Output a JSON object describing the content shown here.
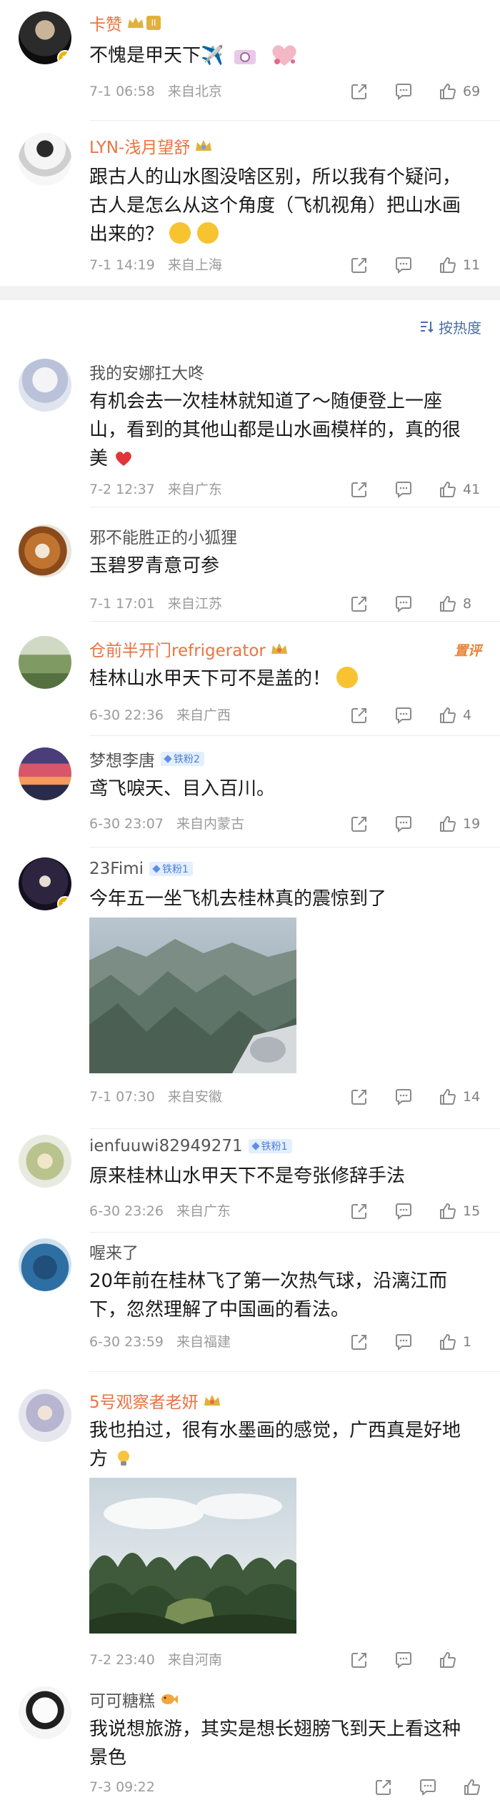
{
  "sort_label": "按热度",
  "comments": [
    {
      "name": "卡赞",
      "text": "不愧是甲天下✈️",
      "time": "7-1 06:58",
      "location": "来自北京",
      "likes": "69"
    },
    {
      "name": "LYN-浅月望舒",
      "text": "跟古人的山水图没啥区别，所以我有个疑问，古人是怎么从这个角度（飞机视角）把山水画出来的？",
      "time": "7-1 14:19",
      "location": "来自上海",
      "likes": "11"
    },
    {
      "name": "我的安娜扛大咚",
      "text": "有机会去一次桂林就知道了～随便登上一座山，看到的其他山都是山水画模样的，真的很美",
      "time": "7-2 12:37",
      "location": "来自广东",
      "likes": "41"
    },
    {
      "name": "邪不能胜正的小狐狸",
      "text": "玉碧罗青意可参",
      "time": "7-1 17:01",
      "location": "来自江苏",
      "likes": "8"
    },
    {
      "name": "仓前半开门refrigerator",
      "pin": "置评",
      "text": "桂林山水甲天下可不是盖的！",
      "time": "6-30 22:36",
      "location": "来自广西",
      "likes": "4"
    },
    {
      "name": "梦想李唐",
      "badge": "铁粉2",
      "text": "鸢飞唳天、目入百川。",
      "time": "6-30 23:07",
      "location": "来自内蒙古",
      "likes": "19"
    },
    {
      "name": "23Fimi",
      "badge": "铁粉1",
      "text": "今年五一坐飞机去桂林真的震惊到了",
      "time": "7-1 07:30",
      "location": "来自安徽",
      "likes": "14"
    },
    {
      "name": "ienfuuwi82949271",
      "badge": "铁粉1",
      "text": "原来桂林山水甲天下不是夸张修辞手法",
      "time": "6-30 23:26",
      "location": "来自广东",
      "likes": "15"
    },
    {
      "name": "喔来了",
      "text": "20年前在桂林飞了第一次热气球，沿漓江而下，忽然理解了中国画的看法。",
      "time": "6-30 23:59",
      "location": "来自福建",
      "likes": "1"
    },
    {
      "name": "5号观察者老妍",
      "text": "我也拍过，很有水墨画的感觉，广西真是好地方",
      "time": "7-2 23:40",
      "location": "来自河南",
      "likes": ""
    },
    {
      "name": "可可糖糕",
      "text": "我说想旅游，其实是想长翅膀飞到天上看这种景色",
      "time": "7-3 09:22",
      "location": "",
      "likes": ""
    }
  ],
  "colors": {
    "name_orange": "#eb7340",
    "meta_gray": "#9b9b9b",
    "link_blue": "#4a6fa5",
    "badge_blue": "#4e7ed2"
  }
}
